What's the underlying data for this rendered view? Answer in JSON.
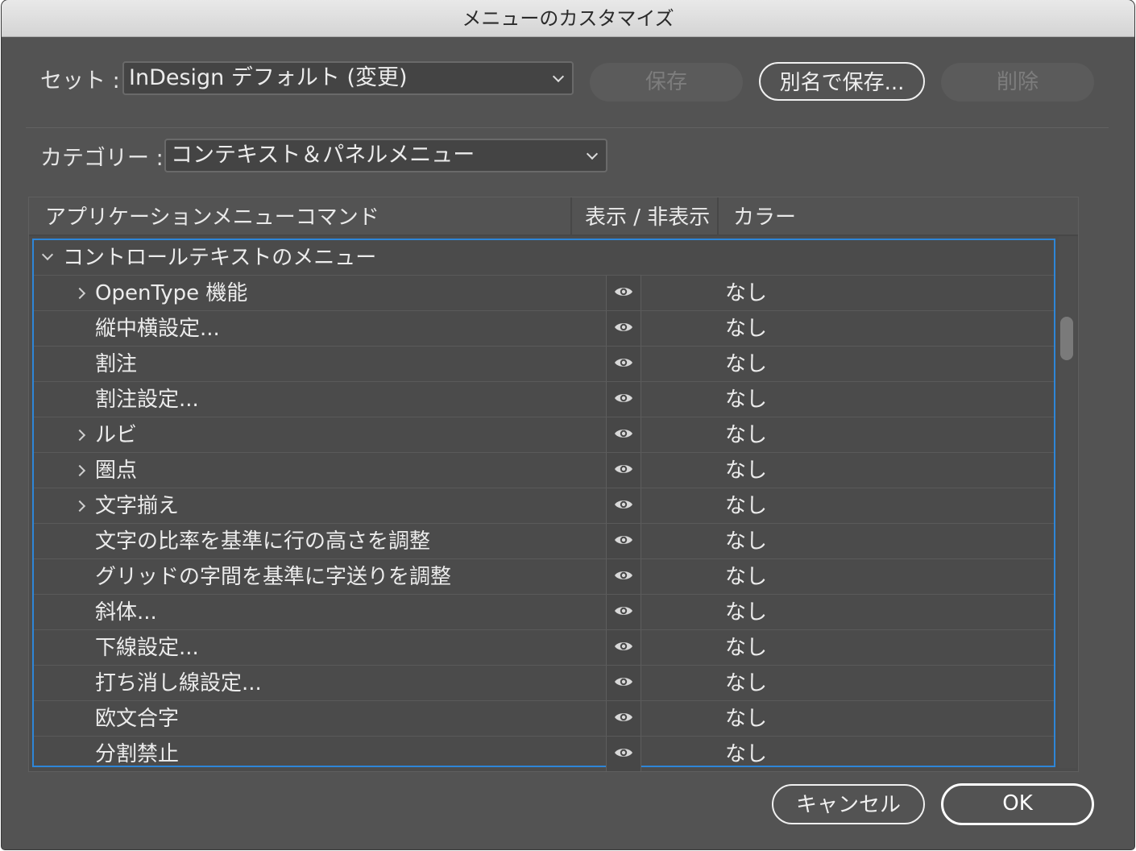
{
  "window": {
    "title": "メニューのカスタマイズ"
  },
  "set": {
    "label": "セット :",
    "value": "InDesign デフォルト (変更)"
  },
  "buttons": {
    "save": "保存",
    "save_as": "別名で保存...",
    "delete": "削除",
    "cancel": "キャンセル",
    "ok": "OK"
  },
  "category": {
    "label": "カテゴリー :",
    "value": "コンテキスト＆パネルメニュー"
  },
  "table": {
    "headers": {
      "command": "アプリケーションメニューコマンド",
      "visibility": "表示 / 非表示",
      "color": "カラー"
    },
    "group": {
      "label": "コントロールテキストのメニュー",
      "expanded": true
    },
    "rows": [
      {
        "label": "OpenType 機能",
        "submenu": true,
        "visible": true,
        "color": "なし"
      },
      {
        "label": "縦中横設定...",
        "submenu": false,
        "visible": true,
        "color": "なし"
      },
      {
        "label": "割注",
        "submenu": false,
        "visible": true,
        "color": "なし"
      },
      {
        "label": "割注設定...",
        "submenu": false,
        "visible": true,
        "color": "なし"
      },
      {
        "label": "ルビ",
        "submenu": true,
        "visible": true,
        "color": "なし"
      },
      {
        "label": "圏点",
        "submenu": true,
        "visible": true,
        "color": "なし"
      },
      {
        "label": "文字揃え",
        "submenu": true,
        "visible": true,
        "color": "なし"
      },
      {
        "label": "文字の比率を基準に行の高さを調整",
        "submenu": false,
        "visible": true,
        "color": "なし"
      },
      {
        "label": "グリッドの字間を基準に字送りを調整",
        "submenu": false,
        "visible": true,
        "color": "なし"
      },
      {
        "label": "斜体...",
        "submenu": false,
        "visible": true,
        "color": "なし"
      },
      {
        "label": "下線設定...",
        "submenu": false,
        "visible": true,
        "color": "なし"
      },
      {
        "label": "打ち消し線設定...",
        "submenu": false,
        "visible": true,
        "color": "なし"
      },
      {
        "label": "欧文合字",
        "submenu": false,
        "visible": true,
        "color": "なし"
      },
      {
        "label": "分割禁止",
        "submenu": false,
        "visible": true,
        "color": "なし"
      }
    ]
  },
  "colors": {
    "accent": "#2e86d8",
    "dialog_bg": "#535353"
  },
  "icons": {
    "visibility": "eye-icon",
    "expand": "chevron-right-icon",
    "collapse": "chevron-down-icon",
    "dropdown": "chevron-down-icon"
  }
}
